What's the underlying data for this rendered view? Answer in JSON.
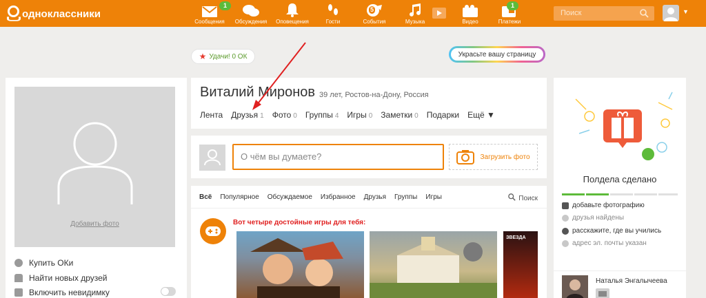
{
  "brand": {
    "name": "одноклассники"
  },
  "nav": [
    {
      "label": "Сообщения",
      "icon": "envelope-icon",
      "badge": "1"
    },
    {
      "label": "Обсуждения",
      "icon": "chat-bubbles-icon",
      "badge": ""
    },
    {
      "label": "Оповещения",
      "icon": "bell-icon",
      "badge": ""
    },
    {
      "label": "Гости",
      "icon": "footprints-icon",
      "badge": ""
    },
    {
      "label": "События",
      "icon": "events-icon",
      "badge": "5"
    },
    {
      "label": "Музыка",
      "icon": "music-note-icon",
      "badge": ""
    },
    {
      "label": "Видео",
      "icon": "video-camera-icon",
      "badge": ""
    },
    {
      "label": "Платежи",
      "icon": "payments-icon",
      "badge": "1"
    }
  ],
  "search": {
    "placeholder": "Поиск"
  },
  "luck": {
    "label": "Удачи! 0 ОК"
  },
  "decorate": {
    "label": "Украсьте вашу страницу"
  },
  "left": {
    "add_photo": "Добавить фото",
    "menu": [
      "Купить ОКи",
      "Найти новых друзей",
      "Включить невидимку"
    ]
  },
  "profile": {
    "name": "Виталий Миронов",
    "meta": "39 лет, Ростов-на-Дону, Россия",
    "tabs": [
      {
        "label": "Лента",
        "count": ""
      },
      {
        "label": "Друзья",
        "count": "1"
      },
      {
        "label": "Фото",
        "count": "0"
      },
      {
        "label": "Группы",
        "count": "4"
      },
      {
        "label": "Игры",
        "count": "0"
      },
      {
        "label": "Заметки",
        "count": "0"
      },
      {
        "label": "Подарки",
        "count": ""
      },
      {
        "label": "Ещё ▼",
        "count": ""
      }
    ]
  },
  "post": {
    "placeholder": "О чём вы думаете?",
    "upload": "Загрузить фото"
  },
  "feed": {
    "tabs": [
      "Всё",
      "Популярное",
      "Обсуждаемое",
      "Избранное",
      "Друзья",
      "Группы",
      "Игры"
    ],
    "search": "Поиск",
    "games_title": "Вот четыре достойные игры для тебя:",
    "game3_label": "ЗВЕЗДА"
  },
  "right": {
    "progress_title": "Полдела сделано",
    "tasks": [
      "добавьте фотографию",
      "друзья найдены",
      "расскажите, где вы учились",
      "адрес эл. почты указан"
    ],
    "friend_name": "Наталья Энгалычеева"
  },
  "colors": {
    "accent": "#ee8208",
    "green": "#5dbb3a",
    "bg": "#efeeec"
  }
}
